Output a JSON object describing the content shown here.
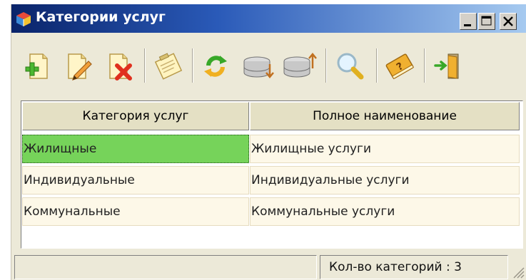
{
  "window": {
    "title": "Категории услуг",
    "controls": [
      "minimize",
      "maximize",
      "close"
    ]
  },
  "toolbar": {
    "buttons": [
      {
        "icon": "add-icon",
        "action": "add"
      },
      {
        "icon": "edit-icon",
        "action": "edit"
      },
      {
        "icon": "delete-icon",
        "action": "delete"
      },
      {
        "icon": "notepad-icon",
        "action": "notes"
      },
      {
        "icon": "refresh-icon",
        "action": "refresh"
      },
      {
        "icon": "db-import-icon",
        "action": "import"
      },
      {
        "icon": "db-export-icon",
        "action": "export"
      },
      {
        "icon": "search-icon",
        "action": "search"
      },
      {
        "icon": "help-book-icon",
        "action": "help"
      },
      {
        "icon": "exit-door-icon",
        "action": "exit"
      }
    ]
  },
  "grid": {
    "columns": [
      "Категория услуг",
      "Полное наименование"
    ],
    "rows": [
      [
        "Жилищные",
        "Жилищные услуги"
      ],
      [
        "Индивидуальные",
        "Индивидуальные услуги"
      ],
      [
        "Коммунальные",
        "Коммунальные услуги"
      ]
    ],
    "selected_row": 0
  },
  "status": {
    "count_label": "Кол-во категорий : 3"
  },
  "colors": {
    "title_start": "#0a246a",
    "title_end": "#a6caf0",
    "selected_cell": "#76d35a",
    "cell_bg": "#fdf8e8",
    "header_bg": "#e4e0c4"
  }
}
